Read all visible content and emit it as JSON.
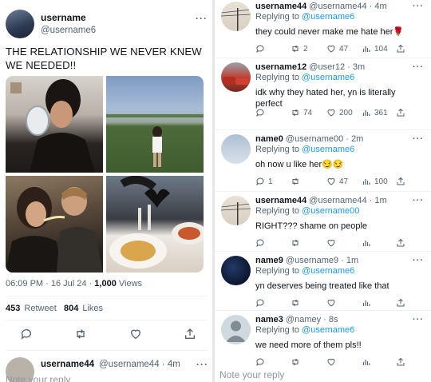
{
  "main_tweet": {
    "name": "username",
    "handle": "@username6",
    "more": "···",
    "text": "THE RELATIONSHIP WE NEVER KNEW WE NEEDED!!",
    "time": "06:09 PM · 16 Jul 24 · ",
    "views_count": "1,000",
    "views_label": " Views",
    "retweets_count": "453",
    "retweets_label": " Retweet",
    "likes_count": "804",
    "likes_label": " Likes",
    "first_reply_name": "username44",
    "first_reply_handle": "@username44 · 4m",
    "note_placeholder": "Note your reply"
  },
  "replies": [
    {
      "name": "username44",
      "meta": "@username44 · 4m",
      "replying_prefix": "Replying to ",
      "replying_to": "@username6",
      "text": "they could never make me hate her🌹",
      "replies": "",
      "retweets": "2",
      "likes": "47",
      "views": "104",
      "avatar": "power-lines-sky"
    },
    {
      "name": "username12",
      "meta": "@user12 · 3m",
      "replying_prefix": "Replying to ",
      "replying_to": "@username6",
      "text": "idk why they hated her, yn is literally perfect",
      "replies": "",
      "retweets": "74",
      "likes": "200",
      "views": "361",
      "avatar": "red-cars"
    },
    {
      "name": "name0",
      "meta": "@username00 · 2m",
      "replying_prefix": "Replying to ",
      "replying_to": "@username6",
      "text": "oh now u like her😏😏",
      "replies": "1",
      "retweets": "",
      "likes": "47",
      "views": "100",
      "avatar": "cloudy-sky"
    },
    {
      "name": "username44",
      "meta": "@username44 · 1m",
      "replying_prefix": "Replying to ",
      "replying_to": "@username00",
      "text": "RIGHT??? shame on people",
      "replies": "",
      "retweets": "",
      "likes": "",
      "views": "",
      "avatar": "power-lines-sky"
    },
    {
      "name": "name9",
      "meta": "@username9 · 1m",
      "replying_prefix": "Replying to ",
      "replying_to": "@username6",
      "text": "yn deserves being treated like that",
      "replies": "",
      "retweets": "",
      "likes": "",
      "views": "",
      "avatar": "dark-blue"
    },
    {
      "name": "name3",
      "meta": "@namey · 8s",
      "replying_prefix": "Replying to ",
      "replying_to": "@username6",
      "text": "we need more of them pls!!",
      "replies": "",
      "retweets": "",
      "likes": "",
      "views": "",
      "avatar": "default-person"
    }
  ],
  "right_note_placeholder": "Note your reply",
  "colors": {
    "accent": "#1d9bf0",
    "muted": "#536471",
    "text": "#0f1419"
  }
}
